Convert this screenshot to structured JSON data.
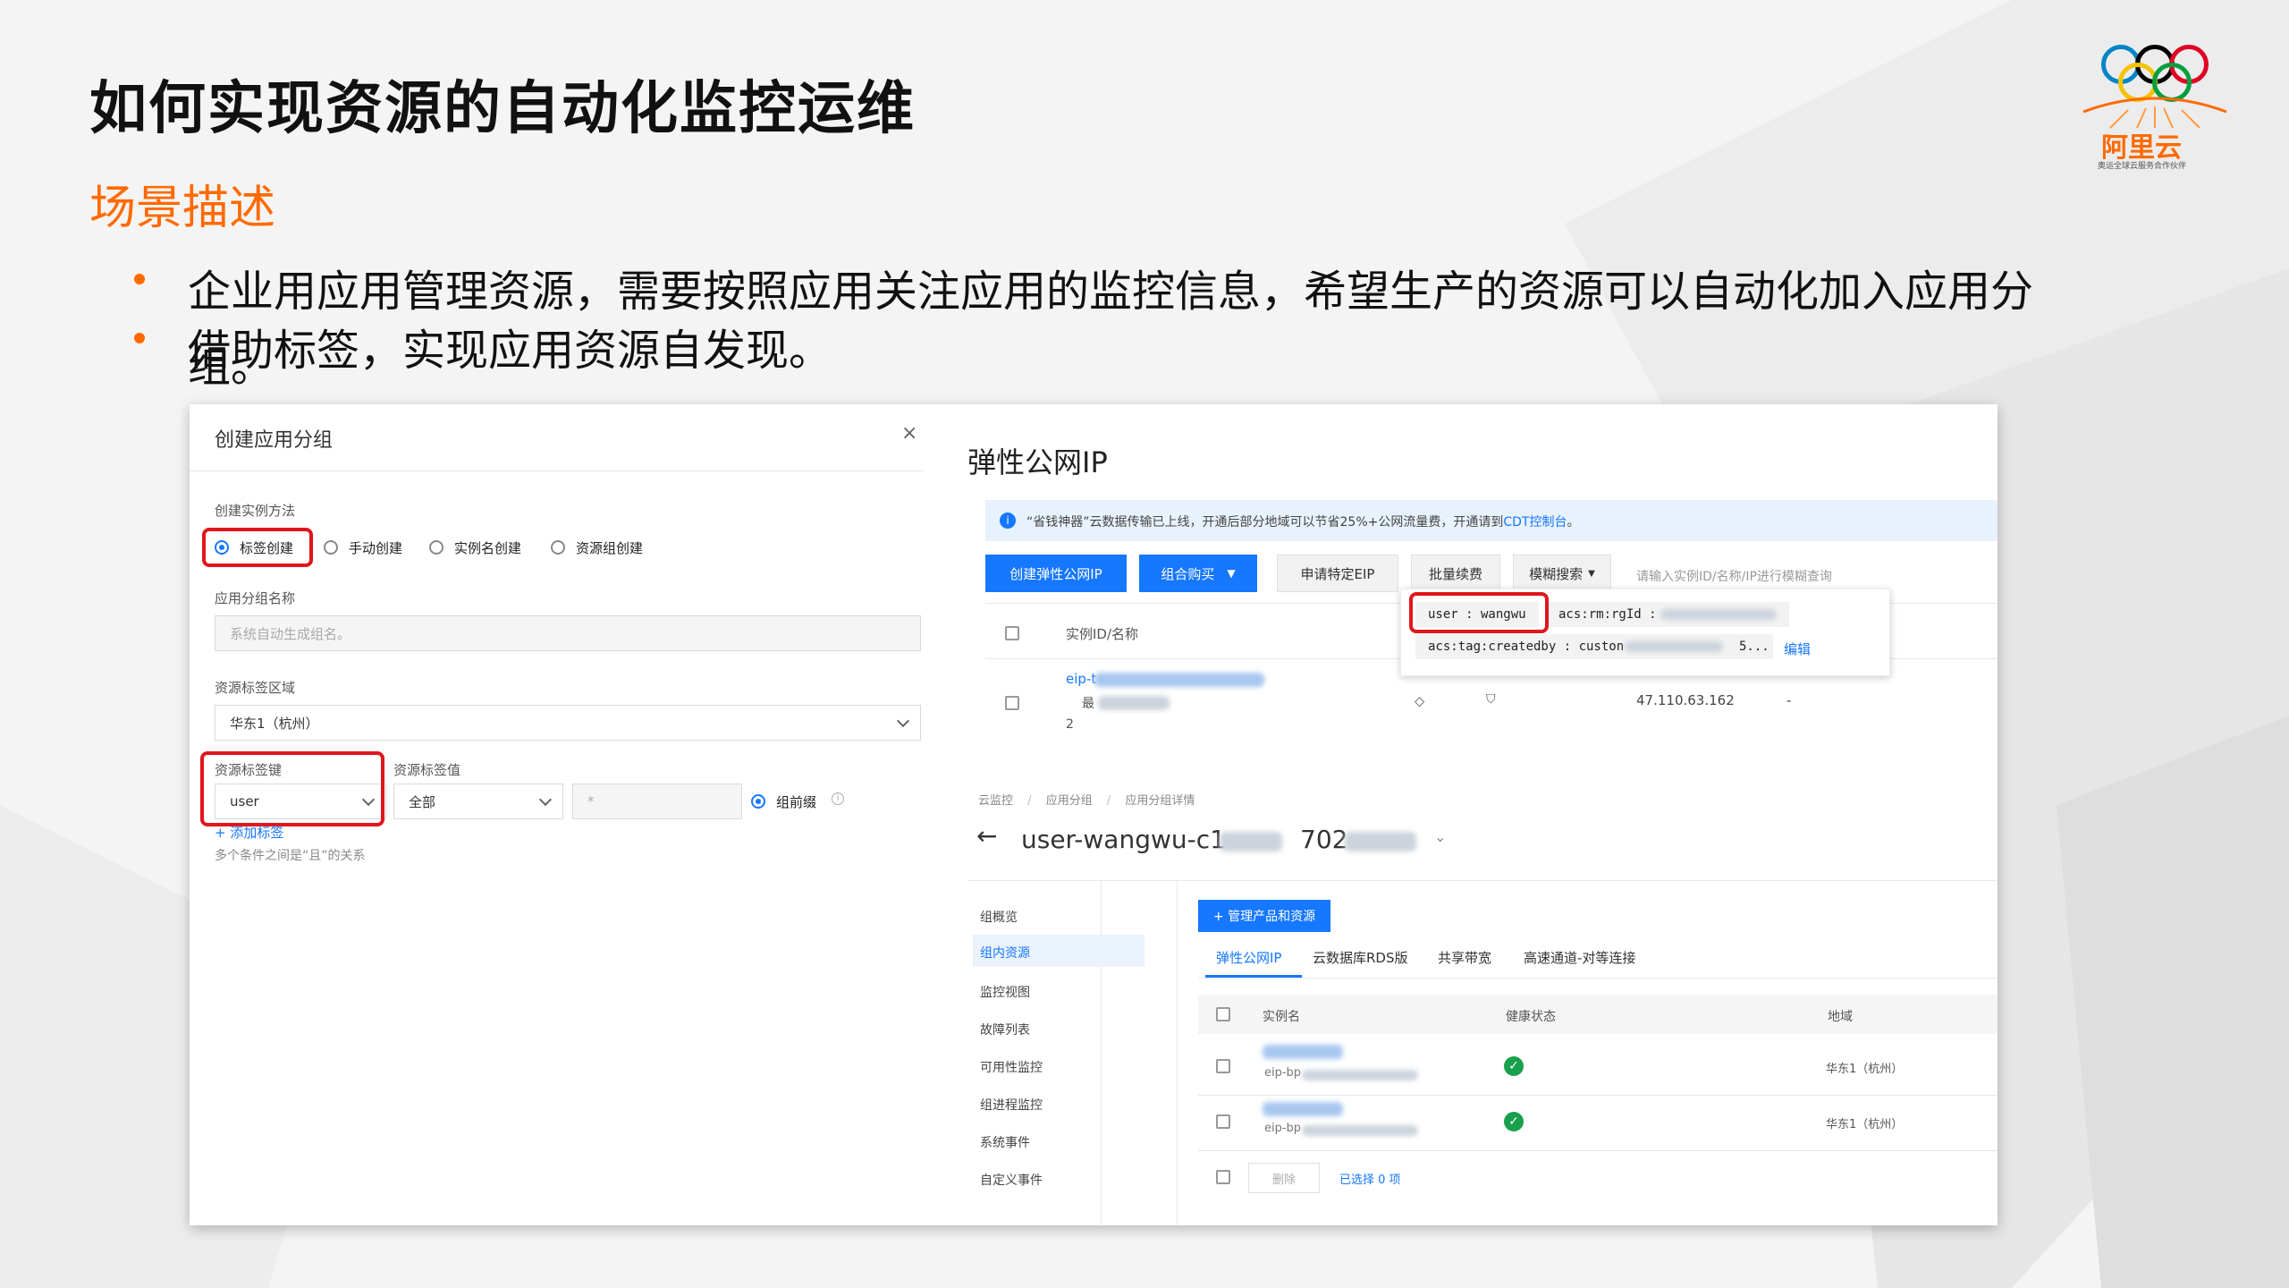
{
  "slide": {
    "title": "如何实现资源的自动化监控运维",
    "subtitle": "场景描述",
    "bullets": [
      "企业用应用管理资源，需要按照应用关注应用的监控信息，希望生产的资源可以自动化加入应用分",
      "借助标签，实现应用资源自发现。"
    ],
    "bullet_overflow": "组。"
  },
  "logo": {
    "brand": "阿里云",
    "sub": "奥运全球云服务合作伙伴",
    "ring_colors": [
      "#0085c7",
      "#f4c300",
      "#000000",
      "#009f3d",
      "#df0024"
    ]
  },
  "left_dialog": {
    "title": "创建应用分组",
    "close_icon": "close-icon",
    "method_label": "创建实例方法",
    "methods": [
      "标签创建",
      "手动创建",
      "实例名创建",
      "资源组创建"
    ],
    "selected_method": "标签创建",
    "group_name_label": "应用分组名称",
    "group_name_placeholder": "系统自动生成组名。",
    "region_label": "资源标签区域",
    "region_value": "华东1（杭州）",
    "tag_key_label": "资源标签键",
    "tag_key_value": "user",
    "tag_value_label": "资源标签值",
    "tag_value_option": "全部",
    "tag_value_input": "*",
    "prefix_label": "组前缀",
    "add_tag": "+ 添加标签",
    "hint": "多个条件之间是“且”的关系"
  },
  "eip_panel": {
    "title": "弹性公网IP",
    "notice": "“省钱神器”云数据传输已上线，开通后部分地域可以节省25%+公网流量费，开通请到",
    "notice_link": "CDT控制台",
    "notice_end": "。",
    "buttons": {
      "create": "创建弹性公网IP",
      "combo": "组合购买",
      "apply": "申请特定EIP",
      "renew": "批量续费",
      "search_mode": "模糊搜索"
    },
    "search_placeholder": "请输入实例ID/名称/IP进行模糊查询",
    "col_instance": "实例ID/名称",
    "row": {
      "id_prefix": "eip-t",
      "name_prefix": "最",
      "count": "2",
      "ip": "47.110.63.162",
      "dash": "-"
    },
    "tag_popup": {
      "tag1": "user : wangwu",
      "tag2": "acs:rm:rgId :",
      "tag3": "acs:tag:createdby : custon",
      "tag3_tail": "5...",
      "edit": "编辑"
    }
  },
  "group_detail": {
    "breadcrumb": [
      "云监控",
      "应用分组",
      "应用分组详情"
    ],
    "name_prefix": "user-wangwu-c1",
    "name_mid": "702",
    "nav": [
      "组概览",
      "组内资源",
      "监控视图",
      "故障列表",
      "可用性监控",
      "组进程监控",
      "系统事件",
      "自定义事件"
    ],
    "active_nav": "组内资源",
    "manage_button": "+ 管理产品和资源",
    "tabs": [
      "弹性公网IP",
      "云数据库RDS版",
      "共享带宽",
      "高速通道-对等连接"
    ],
    "active_tab": "弹性公网IP",
    "columns": [
      "实例名",
      "健康状态",
      "地域"
    ],
    "rows": [
      {
        "sub": "eip-bp",
        "region": "华东1（杭州）"
      },
      {
        "sub": "eip-bp",
        "region": "华东1（杭州）"
      }
    ],
    "delete_btn": "删除",
    "selected": "已选择 0 项"
  }
}
